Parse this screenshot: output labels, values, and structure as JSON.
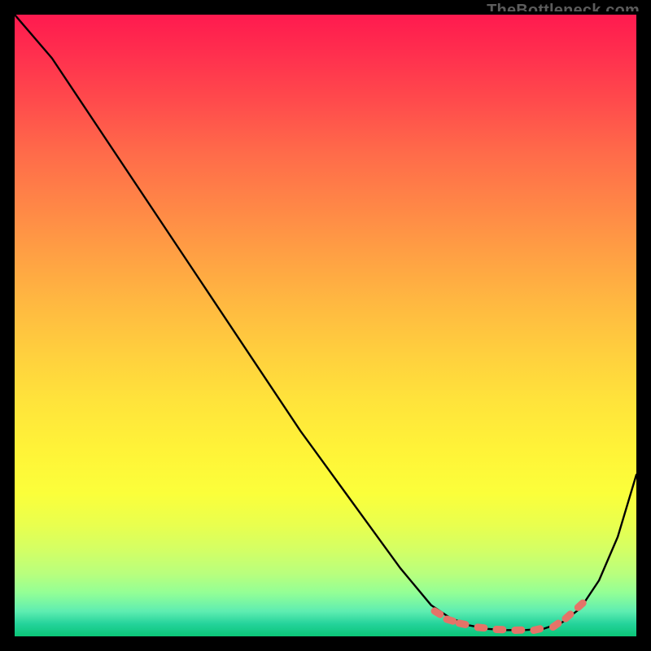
{
  "watermark": "TheBottleneck.com",
  "chart_data": {
    "type": "line",
    "title": "",
    "xlabel": "",
    "ylabel": "",
    "xlim": [
      0,
      100
    ],
    "ylim": [
      0,
      100
    ],
    "series": [
      {
        "name": "curve",
        "x": [
          0,
          6,
          14,
          22,
          30,
          38,
          46,
          54,
          62,
          67,
          70,
          73,
          76,
          79,
          82,
          85,
          88,
          91,
          94,
          97,
          100
        ],
        "y": [
          100,
          93,
          81,
          69,
          57,
          45,
          33,
          22,
          11,
          5,
          3,
          1.8,
          1.2,
          1.0,
          1.0,
          1.2,
          2.2,
          4.5,
          9,
          16,
          26
        ]
      }
    ],
    "markers": {
      "name": "highlight-dashes",
      "color": "#e57368",
      "points": [
        {
          "x": 68,
          "y": 3.8
        },
        {
          "x": 70,
          "y": 2.6
        },
        {
          "x": 72,
          "y": 2.0
        },
        {
          "x": 75,
          "y": 1.4
        },
        {
          "x": 78,
          "y": 1.1
        },
        {
          "x": 81,
          "y": 1.0
        },
        {
          "x": 84,
          "y": 1.1
        },
        {
          "x": 87,
          "y": 1.8
        },
        {
          "x": 89,
          "y": 3.2
        },
        {
          "x": 91,
          "y": 5.0
        }
      ]
    }
  }
}
